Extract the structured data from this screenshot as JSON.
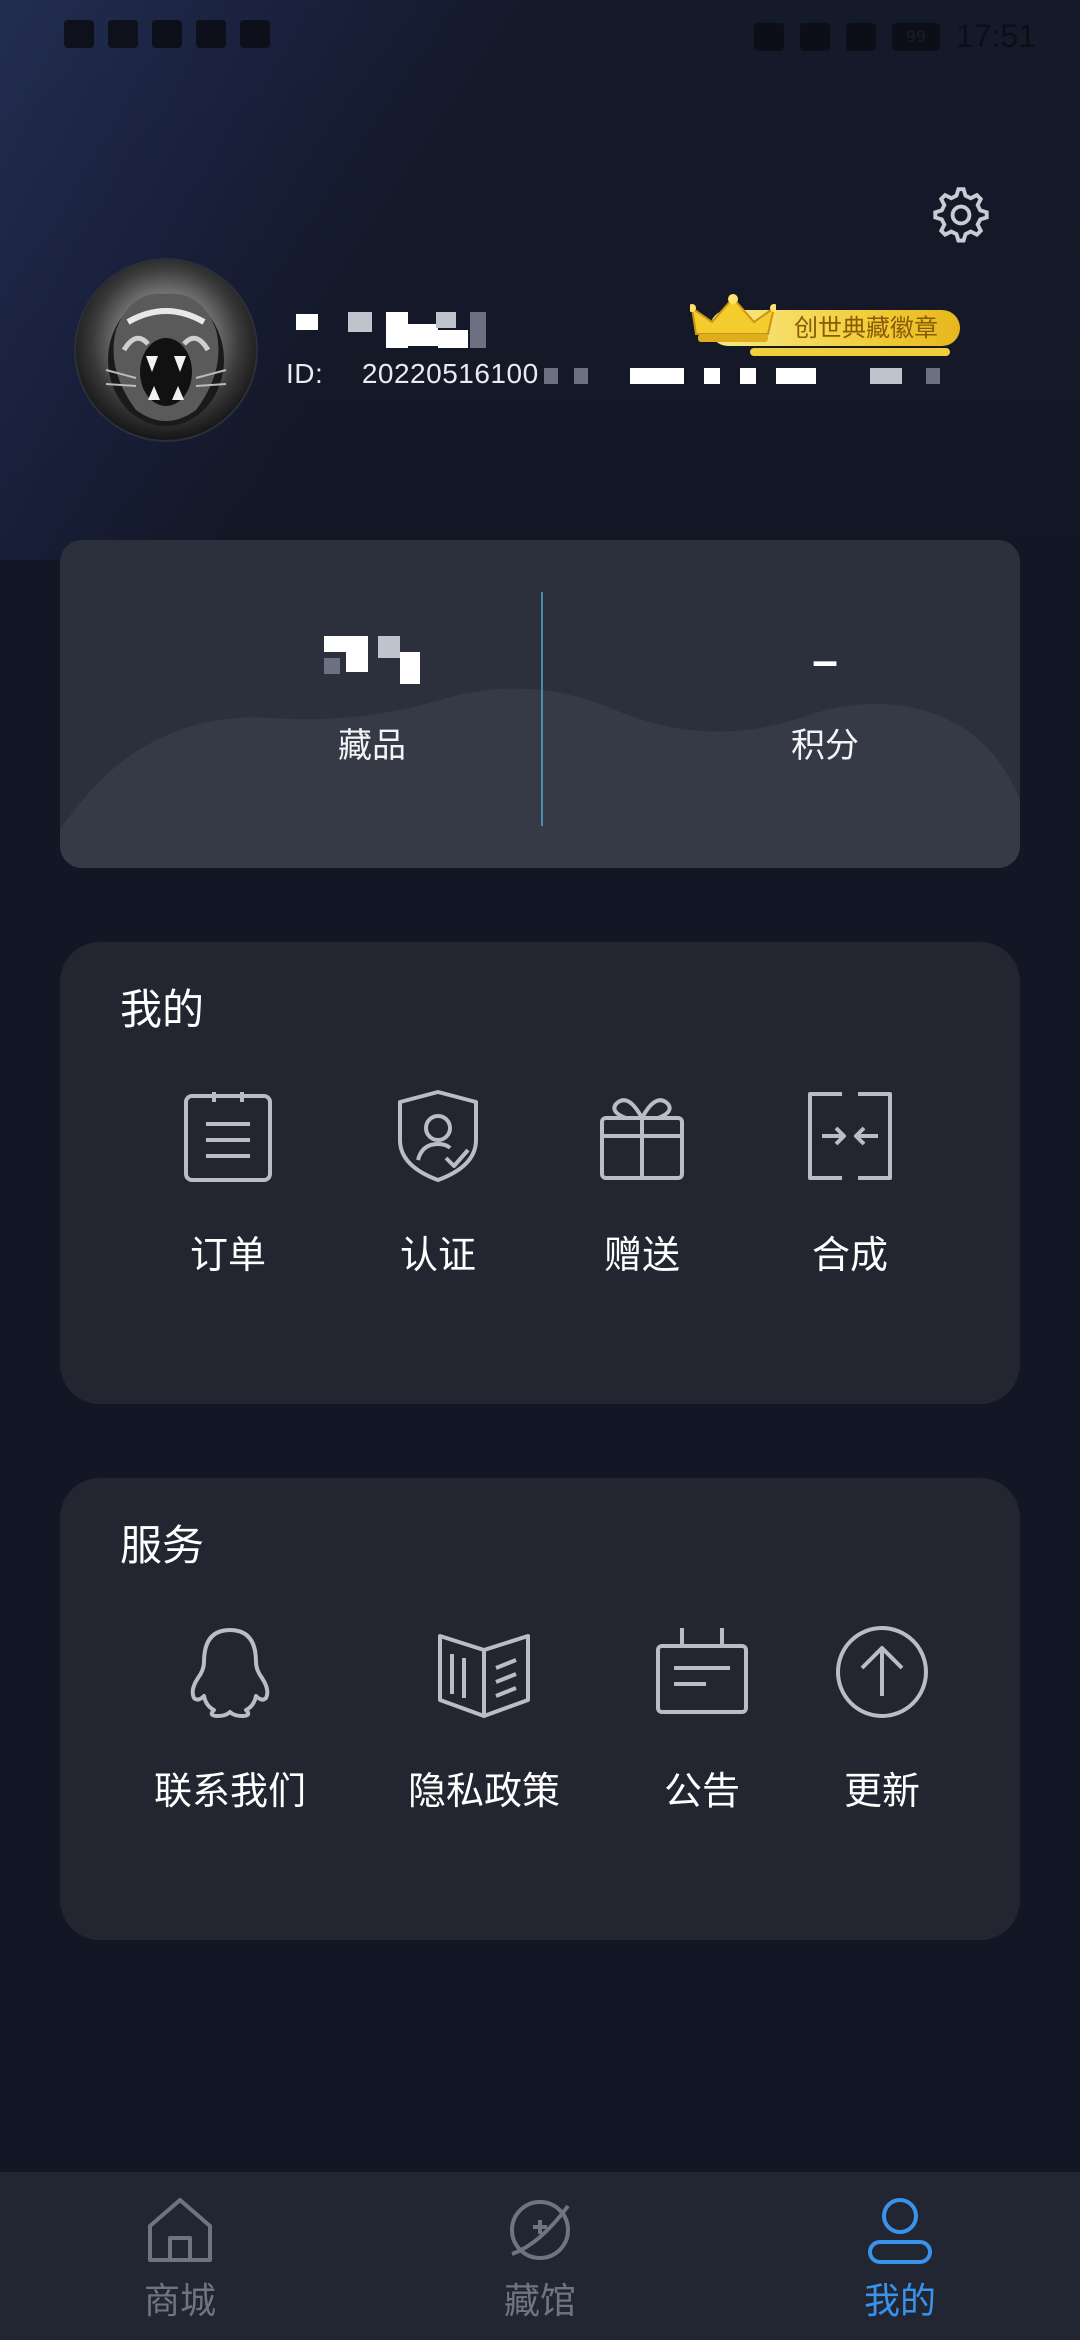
{
  "status_bar": {
    "time": "17:51",
    "battery": "99"
  },
  "profile": {
    "id_label": "ID:",
    "id_value": "20220516100",
    "badge_text": "创世典藏徽章"
  },
  "stats": {
    "collections_label": "藏品",
    "points_value": "–",
    "points_label": "积分"
  },
  "mine": {
    "title": "我的",
    "items": [
      {
        "label": "订单",
        "icon": "order-icon"
      },
      {
        "label": "认证",
        "icon": "verify-shield-icon"
      },
      {
        "label": "赠送",
        "icon": "gift-icon"
      },
      {
        "label": "合成",
        "icon": "merge-icon"
      }
    ]
  },
  "service": {
    "title": "服务",
    "items": [
      {
        "label": "联系我们",
        "icon": "qq-contact-icon"
      },
      {
        "label": "隐私政策",
        "icon": "book-icon"
      },
      {
        "label": "公告",
        "icon": "notice-board-icon"
      },
      {
        "label": "更新",
        "icon": "update-arrow-icon"
      }
    ]
  },
  "tabs": [
    {
      "label": "商城",
      "icon": "home-icon",
      "active": false
    },
    {
      "label": "藏馆",
      "icon": "gallery-icon",
      "active": false
    },
    {
      "label": "我的",
      "icon": "user-icon",
      "active": true
    }
  ],
  "colors": {
    "accent": "#3a93ea",
    "background": "#131725",
    "card": "#232630",
    "badge": "#f2cf3c"
  }
}
